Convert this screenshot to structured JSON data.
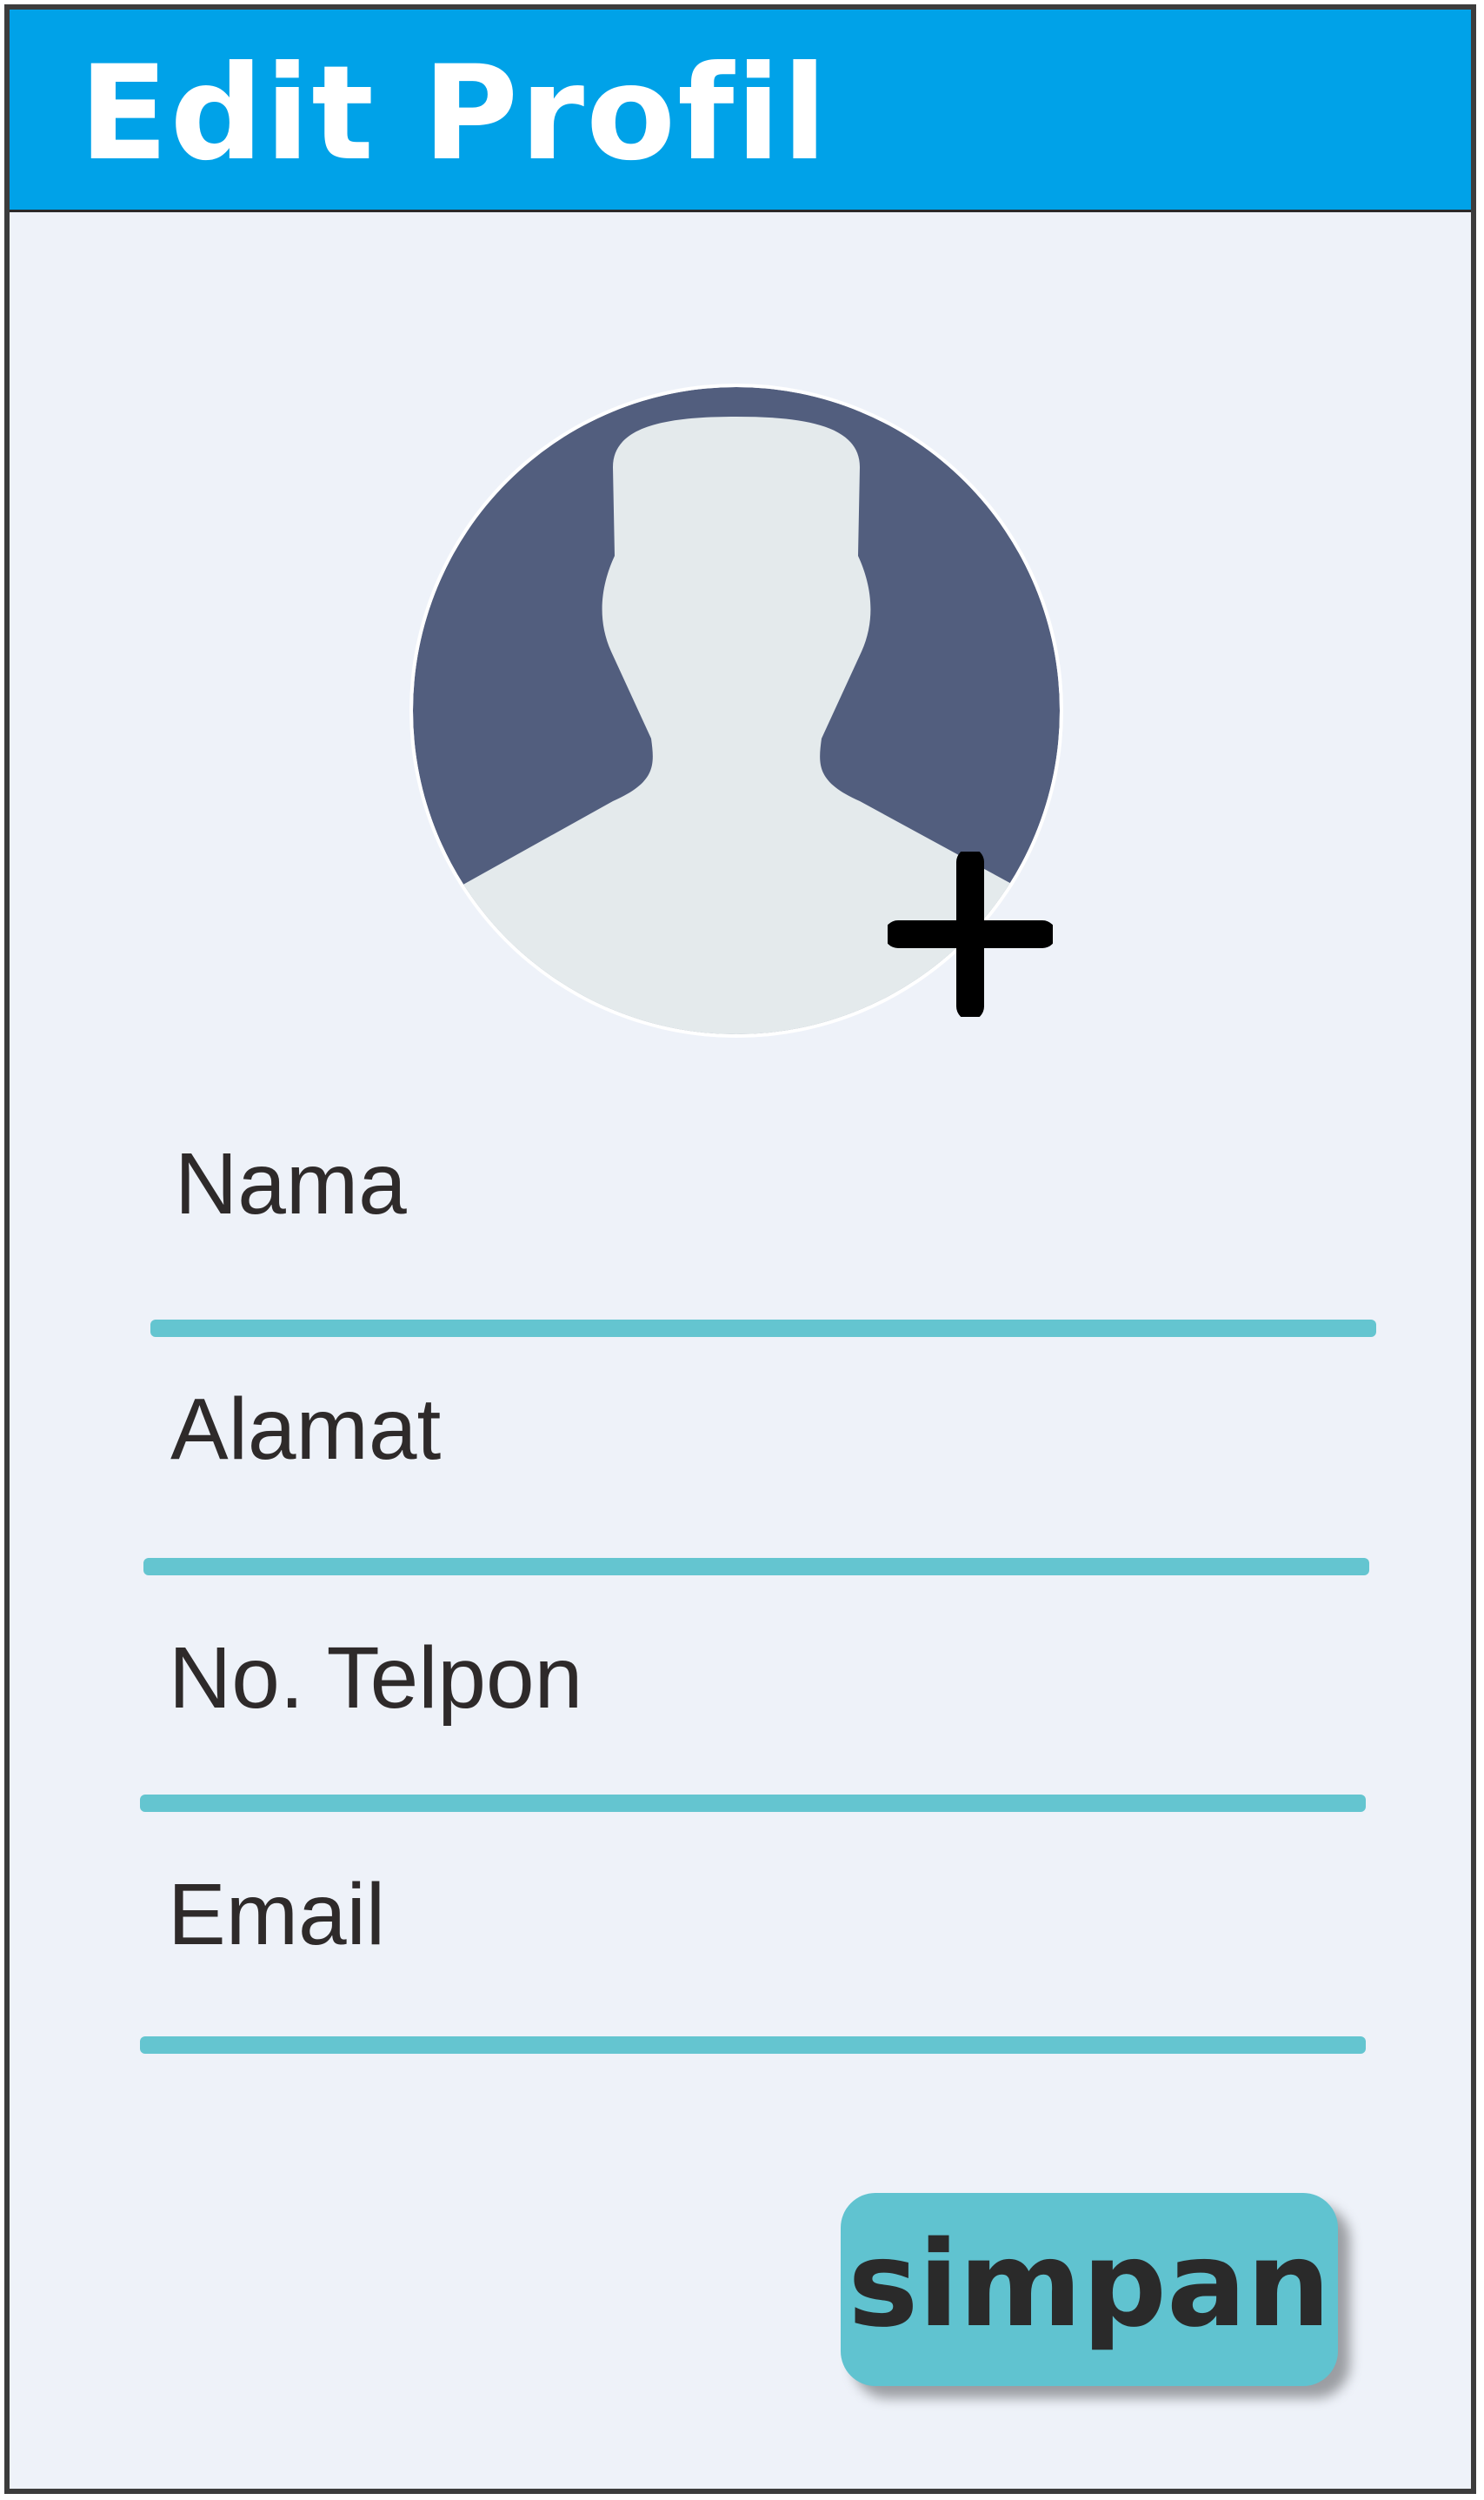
{
  "header": {
    "title": "Edit Profil",
    "background": "#00a2e8"
  },
  "avatar": {
    "icon": "user-silhouette-icon",
    "add_icon": "plus-icon",
    "circle_color": "#525e7e"
  },
  "form": {
    "fields": [
      {
        "label": "Nama",
        "value": ""
      },
      {
        "label": "Alamat",
        "value": ""
      },
      {
        "label": "No. Telpon",
        "value": ""
      },
      {
        "label": "Email",
        "value": ""
      }
    ],
    "underline_color": "#64c5d0"
  },
  "actions": {
    "save_label": "simpan",
    "save_color": "#60c3d0"
  }
}
